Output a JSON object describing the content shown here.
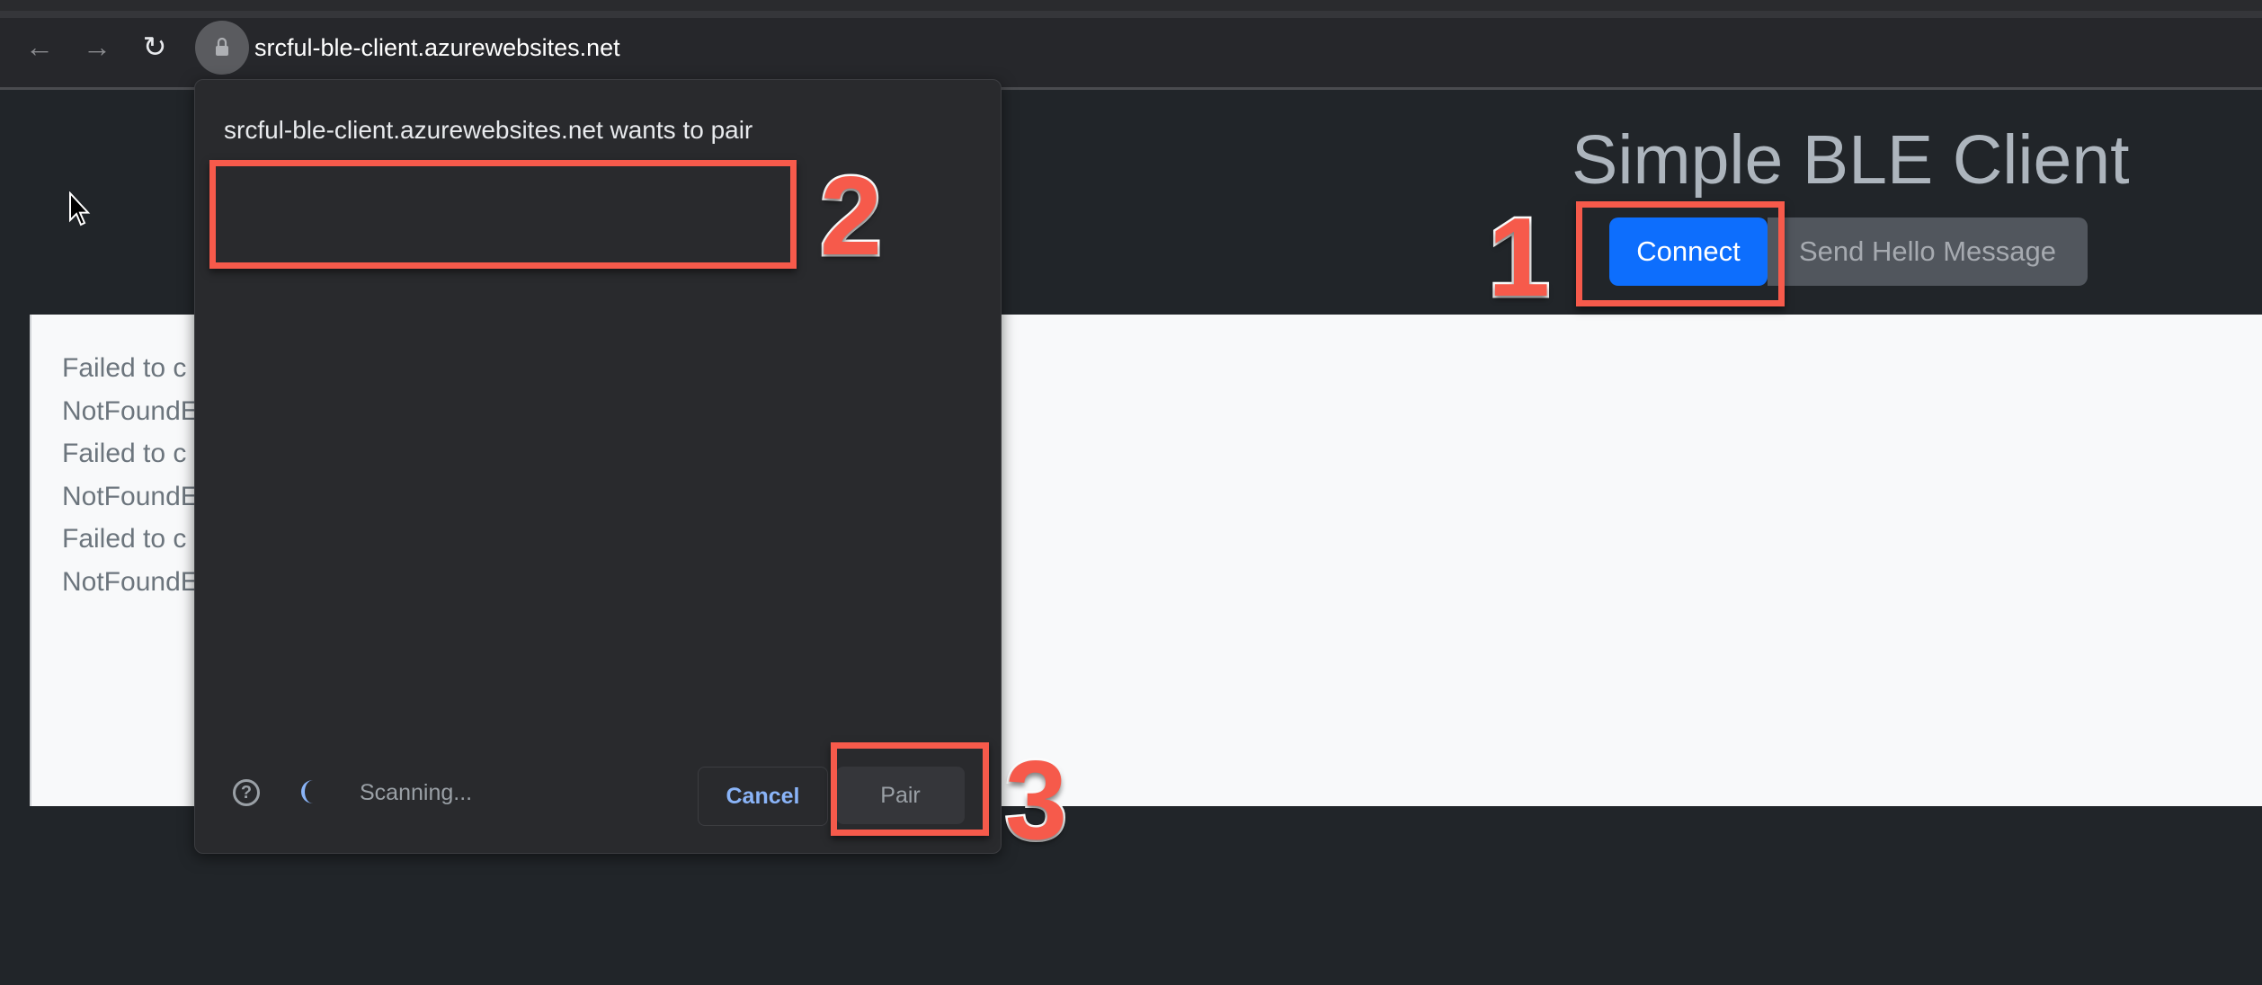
{
  "browser": {
    "url": "srcful-ble-client.azurewebsites.net",
    "icons": [
      "back-arrow-icon",
      "forward-arrow-icon",
      "reload-icon",
      "lock-icon"
    ]
  },
  "page": {
    "title": "Simple BLE Client",
    "connect_label": "Connect",
    "send_hello_label": "Send Hello Message",
    "log_lines": [
      "Failed to c",
      "NotFoundE",
      "Failed to c",
      "NotFoundE",
      "Failed to c",
      "NotFoundE"
    ],
    "colors": {
      "connect": "#0d6efd",
      "secondary": "#51565d",
      "background": "#212529"
    }
  },
  "dialog": {
    "title": "srcful-ble-client.azurewebsites.net wants to pair",
    "status": "Scanning...",
    "cancel_label": "Cancel",
    "pair_label": "Pair"
  },
  "annotations": {
    "step1": "1",
    "step2": "2",
    "step3": "3",
    "color": "#f65a4b"
  }
}
